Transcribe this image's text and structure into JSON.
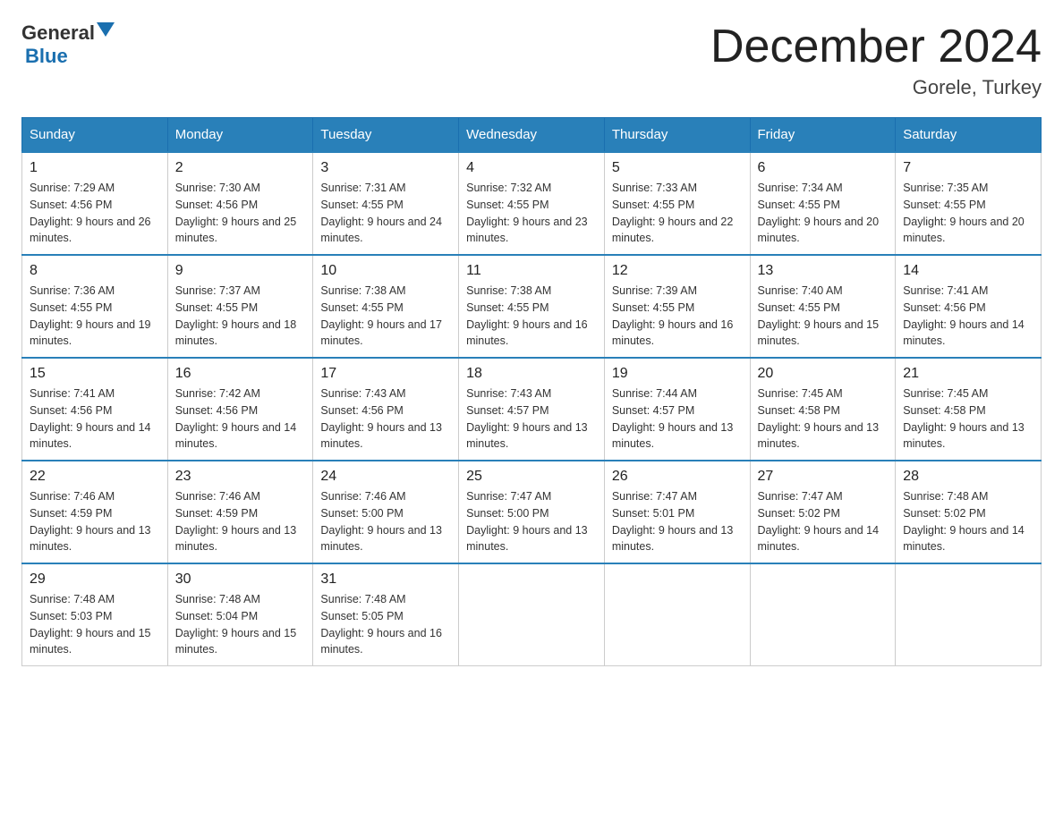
{
  "header": {
    "logo_general": "General",
    "logo_blue": "Blue",
    "month_title": "December 2024",
    "location": "Gorele, Turkey"
  },
  "days_of_week": [
    "Sunday",
    "Monday",
    "Tuesday",
    "Wednesday",
    "Thursday",
    "Friday",
    "Saturday"
  ],
  "weeks": [
    [
      {
        "day": "1",
        "sunrise": "7:29 AM",
        "sunset": "4:56 PM",
        "daylight": "9 hours and 26 minutes."
      },
      {
        "day": "2",
        "sunrise": "7:30 AM",
        "sunset": "4:56 PM",
        "daylight": "9 hours and 25 minutes."
      },
      {
        "day": "3",
        "sunrise": "7:31 AM",
        "sunset": "4:55 PM",
        "daylight": "9 hours and 24 minutes."
      },
      {
        "day": "4",
        "sunrise": "7:32 AM",
        "sunset": "4:55 PM",
        "daylight": "9 hours and 23 minutes."
      },
      {
        "day": "5",
        "sunrise": "7:33 AM",
        "sunset": "4:55 PM",
        "daylight": "9 hours and 22 minutes."
      },
      {
        "day": "6",
        "sunrise": "7:34 AM",
        "sunset": "4:55 PM",
        "daylight": "9 hours and 20 minutes."
      },
      {
        "day": "7",
        "sunrise": "7:35 AM",
        "sunset": "4:55 PM",
        "daylight": "9 hours and 20 minutes."
      }
    ],
    [
      {
        "day": "8",
        "sunrise": "7:36 AM",
        "sunset": "4:55 PM",
        "daylight": "9 hours and 19 minutes."
      },
      {
        "day": "9",
        "sunrise": "7:37 AM",
        "sunset": "4:55 PM",
        "daylight": "9 hours and 18 minutes."
      },
      {
        "day": "10",
        "sunrise": "7:38 AM",
        "sunset": "4:55 PM",
        "daylight": "9 hours and 17 minutes."
      },
      {
        "day": "11",
        "sunrise": "7:38 AM",
        "sunset": "4:55 PM",
        "daylight": "9 hours and 16 minutes."
      },
      {
        "day": "12",
        "sunrise": "7:39 AM",
        "sunset": "4:55 PM",
        "daylight": "9 hours and 16 minutes."
      },
      {
        "day": "13",
        "sunrise": "7:40 AM",
        "sunset": "4:55 PM",
        "daylight": "9 hours and 15 minutes."
      },
      {
        "day": "14",
        "sunrise": "7:41 AM",
        "sunset": "4:56 PM",
        "daylight": "9 hours and 14 minutes."
      }
    ],
    [
      {
        "day": "15",
        "sunrise": "7:41 AM",
        "sunset": "4:56 PM",
        "daylight": "9 hours and 14 minutes."
      },
      {
        "day": "16",
        "sunrise": "7:42 AM",
        "sunset": "4:56 PM",
        "daylight": "9 hours and 14 minutes."
      },
      {
        "day": "17",
        "sunrise": "7:43 AM",
        "sunset": "4:56 PM",
        "daylight": "9 hours and 13 minutes."
      },
      {
        "day": "18",
        "sunrise": "7:43 AM",
        "sunset": "4:57 PM",
        "daylight": "9 hours and 13 minutes."
      },
      {
        "day": "19",
        "sunrise": "7:44 AM",
        "sunset": "4:57 PM",
        "daylight": "9 hours and 13 minutes."
      },
      {
        "day": "20",
        "sunrise": "7:45 AM",
        "sunset": "4:58 PM",
        "daylight": "9 hours and 13 minutes."
      },
      {
        "day": "21",
        "sunrise": "7:45 AM",
        "sunset": "4:58 PM",
        "daylight": "9 hours and 13 minutes."
      }
    ],
    [
      {
        "day": "22",
        "sunrise": "7:46 AM",
        "sunset": "4:59 PM",
        "daylight": "9 hours and 13 minutes."
      },
      {
        "day": "23",
        "sunrise": "7:46 AM",
        "sunset": "4:59 PM",
        "daylight": "9 hours and 13 minutes."
      },
      {
        "day": "24",
        "sunrise": "7:46 AM",
        "sunset": "5:00 PM",
        "daylight": "9 hours and 13 minutes."
      },
      {
        "day": "25",
        "sunrise": "7:47 AM",
        "sunset": "5:00 PM",
        "daylight": "9 hours and 13 minutes."
      },
      {
        "day": "26",
        "sunrise": "7:47 AM",
        "sunset": "5:01 PM",
        "daylight": "9 hours and 13 minutes."
      },
      {
        "day": "27",
        "sunrise": "7:47 AM",
        "sunset": "5:02 PM",
        "daylight": "9 hours and 14 minutes."
      },
      {
        "day": "28",
        "sunrise": "7:48 AM",
        "sunset": "5:02 PM",
        "daylight": "9 hours and 14 minutes."
      }
    ],
    [
      {
        "day": "29",
        "sunrise": "7:48 AM",
        "sunset": "5:03 PM",
        "daylight": "9 hours and 15 minutes."
      },
      {
        "day": "30",
        "sunrise": "7:48 AM",
        "sunset": "5:04 PM",
        "daylight": "9 hours and 15 minutes."
      },
      {
        "day": "31",
        "sunrise": "7:48 AM",
        "sunset": "5:05 PM",
        "daylight": "9 hours and 16 minutes."
      },
      null,
      null,
      null,
      null
    ]
  ]
}
